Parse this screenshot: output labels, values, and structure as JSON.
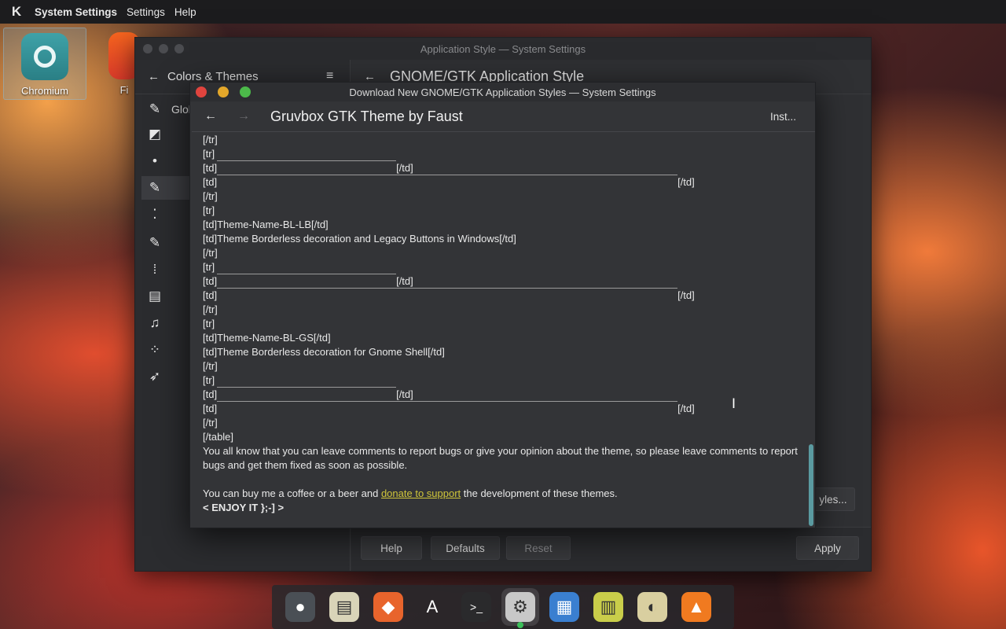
{
  "top_panel": {
    "app_name": "System Settings",
    "menus": [
      "Settings",
      "Help"
    ]
  },
  "desktop": {
    "icons": [
      {
        "label": "Chromium",
        "icon": "chromium-icon"
      },
      {
        "label": "Fi",
        "icon": "firefox-icon"
      }
    ]
  },
  "sys_window": {
    "title": "Application Style — System Settings",
    "sidebar_title": "Colors & Themes",
    "sidebar_items": [
      {
        "label": "Glob",
        "icon": "paintbrush-icon"
      },
      {
        "label": "",
        "icon": "color-palette-icon"
      },
      {
        "label": "",
        "icon": "bulb-icon"
      },
      {
        "label": "",
        "icon": "brush-icon"
      },
      {
        "label": "",
        "icon": "window-decoration-icon"
      },
      {
        "label": "",
        "icon": "brush-alt-icon"
      },
      {
        "label": "",
        "icon": "grid-icon"
      },
      {
        "label": "",
        "icon": "toggle-icon"
      },
      {
        "label": "",
        "icon": "music-icon"
      },
      {
        "label": "",
        "icon": "spinner-icon"
      },
      {
        "label": "",
        "icon": "rocket-icon"
      }
    ],
    "page_title": "GNOME/GTK Application Style",
    "side_button_label": "yles...",
    "buttons": {
      "help": "Help",
      "defaults": "Defaults",
      "reset": "Reset",
      "apply": "Apply"
    }
  },
  "dialog": {
    "title": "Download New GNOME/GTK Application Styles — System Settings",
    "header_title": "Gruvbox GTK Theme by Faust",
    "install_label": "Inst...",
    "lines": [
      {
        "t": "[/tr]"
      },
      {
        "t": "[tr]"
      },
      {
        "t": "[td]",
        "rule": 228,
        "end": "[/td]"
      },
      {
        "t": "[td]",
        "rule": 586,
        "end": "[/td]"
      },
      {
        "t": "[/tr]"
      },
      {
        "t": "[tr]"
      },
      {
        "t": "[td]Theme-Name-BL-LB[/td]"
      },
      {
        "t": "[td]Theme Borderless decoration and Legacy Buttons in Windows[/td]"
      },
      {
        "t": "[/tr]"
      },
      {
        "t": "[tr]"
      },
      {
        "t": "[td]",
        "rule": 228,
        "end": "[/td]"
      },
      {
        "t": "[td]",
        "rule": 586,
        "end": "[/td]"
      },
      {
        "t": "[/tr]"
      },
      {
        "t": "[tr]"
      },
      {
        "t": "[td]Theme-Name-BL-GS[/td]"
      },
      {
        "t": "[td]Theme Borderless decoration for Gnome Shell[/td]"
      },
      {
        "t": "[/tr]"
      },
      {
        "t": "[tr]"
      },
      {
        "t": "[td]",
        "rule": 228,
        "end": "[/td]"
      },
      {
        "t": "[td]",
        "rule": 586,
        "end": "[/td]"
      },
      {
        "t": "[/tr]"
      },
      {
        "t": "[/table]"
      }
    ],
    "paragraph": "You all know that you can leave comments to report bugs or give your opinion about the theme, so please leave comments to report bugs and get them fixed as soon as possible.",
    "donate_before": "You can buy me a coffee or a beer and ",
    "donate_link": "donate to support",
    "donate_after": " the development of these themes.",
    "enjoy": "< ENJOY IT };-] >"
  },
  "dock": {
    "items": [
      {
        "name": "mastodon-icon",
        "glyph": "●",
        "bg": "#4a4f55"
      },
      {
        "name": "file-manager-icon",
        "glyph": "▤",
        "bg": "#d9d4b8"
      },
      {
        "name": "gitlab-icon",
        "glyph": "◆",
        "bg": "#e8642c"
      },
      {
        "name": "font-viewer-icon",
        "glyph": "A",
        "bg": "transparent"
      },
      {
        "name": "terminal-icon",
        "glyph": ">_",
        "bg": "#2a2a2c"
      },
      {
        "name": "system-settings-icon",
        "glyph": "⚙",
        "bg": "#c8c8c8"
      },
      {
        "name": "document-viewer-icon",
        "glyph": "▦",
        "bg": "#3a7fd0"
      },
      {
        "name": "archive-icon",
        "glyph": "▥",
        "bg": "#c9cd4a"
      },
      {
        "name": "gimp-icon",
        "glyph": "◐",
        "bg": "#d9cfa0"
      },
      {
        "name": "vlc-icon",
        "glyph": "▲",
        "bg": "#f07a20"
      }
    ]
  }
}
